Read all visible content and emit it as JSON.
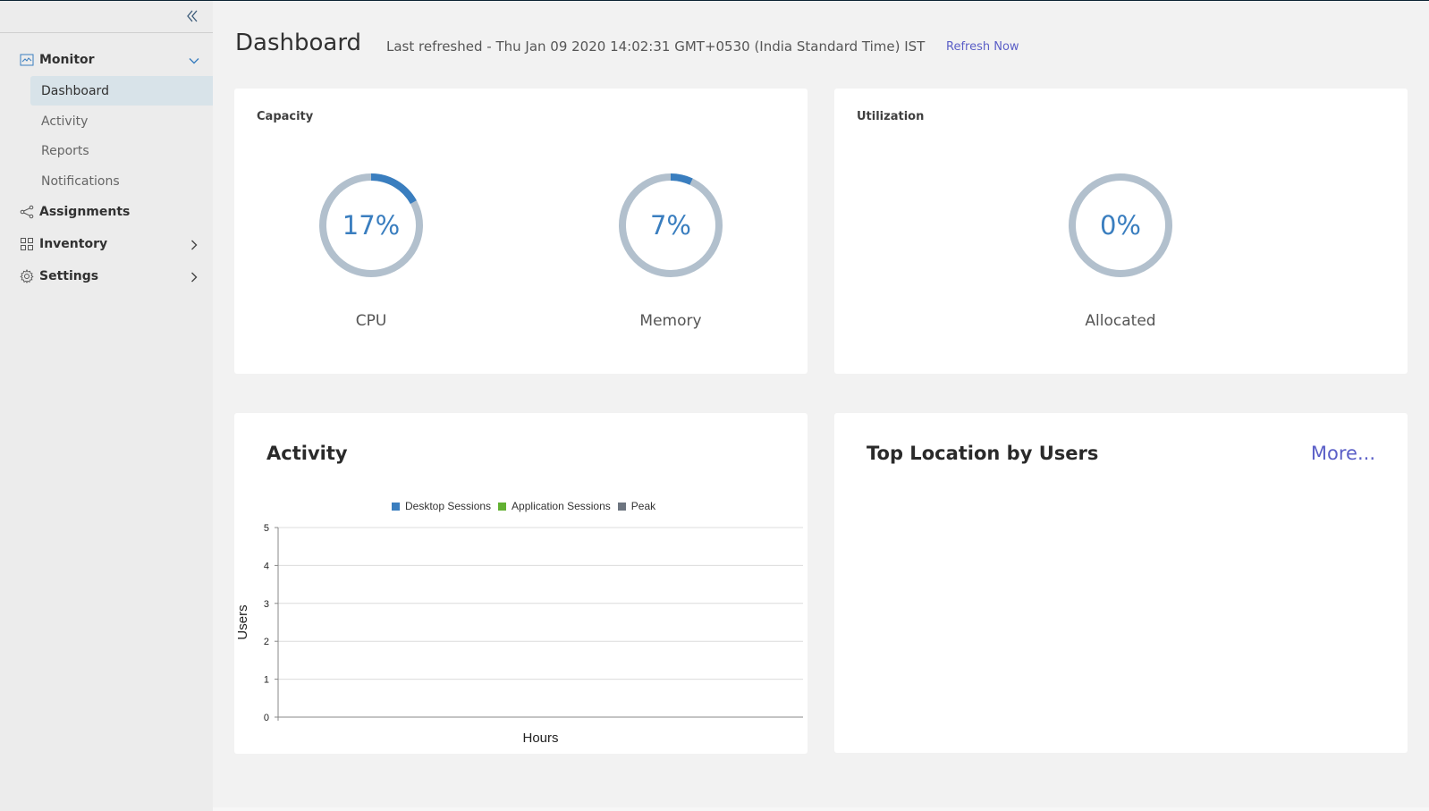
{
  "sidebar": {
    "collapse_icon": "double-chevron-left-icon",
    "groups": [
      {
        "label": "Monitor",
        "icon": "monitor-chart-icon",
        "expanded": true,
        "items": [
          {
            "label": "Dashboard",
            "active": true
          },
          {
            "label": "Activity",
            "active": false
          },
          {
            "label": "Reports",
            "active": false
          },
          {
            "label": "Notifications",
            "active": false
          }
        ]
      },
      {
        "label": "Assignments",
        "icon": "share-nodes-icon",
        "expanded": false
      },
      {
        "label": "Inventory",
        "icon": "grid-icon",
        "expanded": false
      },
      {
        "label": "Settings",
        "icon": "gear-icon",
        "expanded": false
      }
    ]
  },
  "header": {
    "title": "Dashboard",
    "last_refreshed": "Last refreshed - Thu Jan 09 2020 14:02:31 GMT+0530 (India Standard Time) IST",
    "refresh_link": "Refresh Now"
  },
  "capacity": {
    "title": "Capacity",
    "gauges": [
      {
        "label": "CPU",
        "value_text": "17%",
        "percent": 17
      },
      {
        "label": "Memory",
        "value_text": "7%",
        "percent": 7
      }
    ]
  },
  "utilization": {
    "title": "Utilization",
    "gauges": [
      {
        "label": "Allocated",
        "value_text": "0%",
        "percent": 0
      }
    ]
  },
  "activity": {
    "title": "Activity"
  },
  "top_location": {
    "title": "Top Location by Users",
    "more_link": "More..."
  },
  "colors": {
    "accent": "#3a7ebf",
    "gauge_track": "#b2c0cd",
    "link": "#5b5fc7",
    "desktop": "#3a7ebf",
    "application": "#62b132",
    "peak": "#6d7580"
  },
  "chart_data": {
    "type": "bar",
    "title": "Activity",
    "xlabel": "Hours",
    "ylabel": "Users",
    "ylim": [
      0,
      5
    ],
    "yticks": [
      "0",
      "1",
      "2",
      "3",
      "4",
      "5"
    ],
    "grid": true,
    "legend_position": "top-center",
    "categories": [],
    "series": [
      {
        "name": "Desktop Sessions",
        "color": "#3a7ebf",
        "values": []
      },
      {
        "name": "Application Sessions",
        "color": "#62b132",
        "values": []
      },
      {
        "name": "Peak",
        "color": "#6d7580",
        "values": []
      }
    ]
  }
}
